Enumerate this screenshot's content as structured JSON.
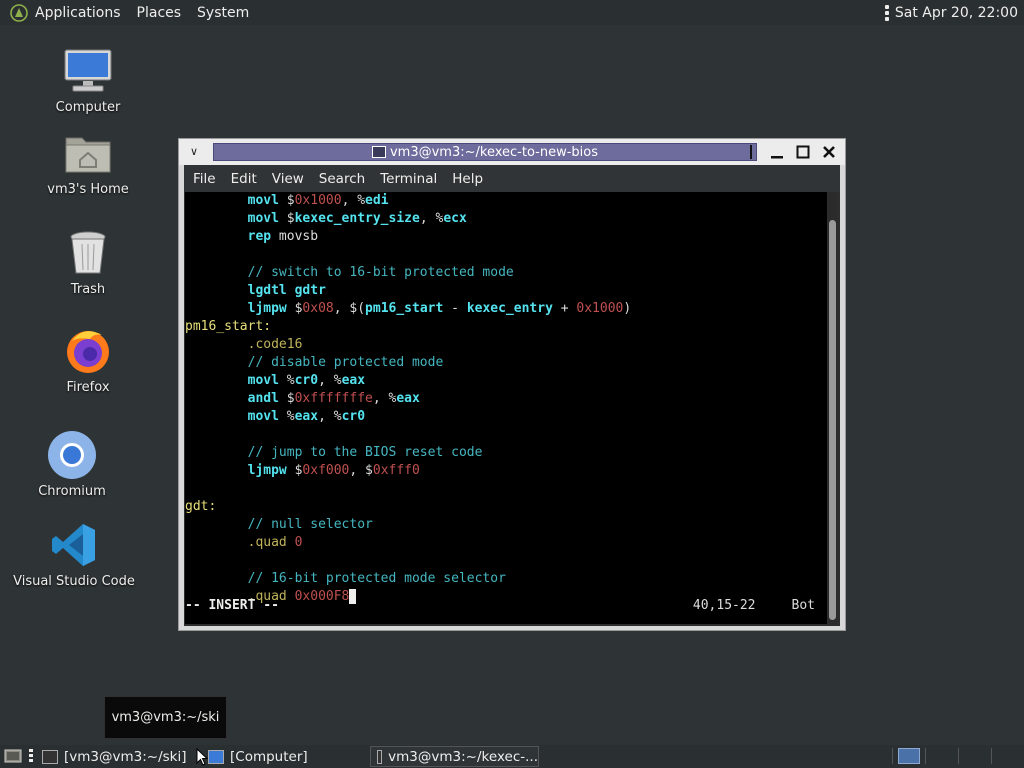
{
  "top_panel": {
    "menus": [
      "Applications",
      "Places",
      "System"
    ],
    "clock": "Sat Apr 20, 22:00"
  },
  "desktop_icons": [
    {
      "label": "Computer",
      "icon": "computer-icon"
    },
    {
      "label": "vm3's Home",
      "icon": "home-folder-icon"
    },
    {
      "label": "Trash",
      "icon": "trash-icon"
    },
    {
      "label": "Firefox",
      "icon": "firefox-icon"
    },
    {
      "label": "Chromium",
      "icon": "chromium-icon"
    },
    {
      "label": "Visual Studio Code",
      "icon": "vscode-icon"
    }
  ],
  "terminal": {
    "title": "vm3@vm3:~/kexec-to-new-bios",
    "menu": [
      "File",
      "Edit",
      "View",
      "Search",
      "Terminal",
      "Help"
    ],
    "lines": [
      "        movl $0x1000, %edi",
      "        movl $kexec_entry_size, %ecx",
      "        rep movsb",
      "",
      "        // switch to 16-bit protected mode",
      "        lgdtl gdtr",
      "        ljmpw $0x08, $(pm16_start - kexec_entry + 0x1000)",
      "pm16_start:",
      "        .code16",
      "        // disable protected mode",
      "        movl %cr0, %eax",
      "        andl $0xfffffffe, %eax",
      "        movl %eax, %cr0",
      "",
      "        // jump to the BIOS reset code",
      "        ljmpw $0xf000, $0xfff0",
      "",
      "gdt:",
      "        // null selector",
      "        .quad 0",
      "",
      "        // 16-bit protected mode selector",
      "        .quad 0x000F8"
    ],
    "mode": "-- INSERT --",
    "position": "40,15-22",
    "scroll": "Bot"
  },
  "tooltip": "vm3@vm3:~/ski",
  "taskbar": {
    "tasks": [
      {
        "label": "[vm3@vm3:~/ski]",
        "active": false
      },
      {
        "label": "[Computer]",
        "active": false
      },
      {
        "label": "vm3@vm3:~/kexec-...",
        "active": true
      }
    ]
  }
}
